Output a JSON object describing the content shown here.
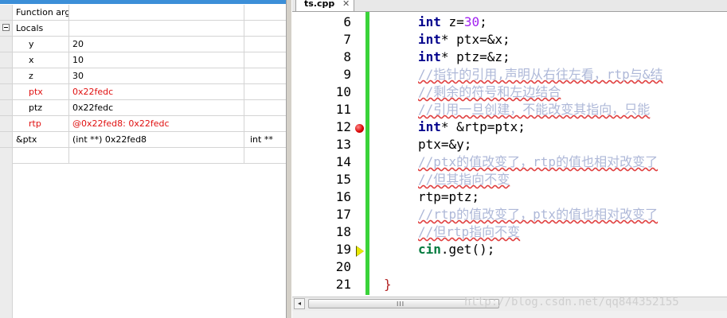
{
  "watch": {
    "function_arg_label": "Function arg",
    "locals_label": "Locals",
    "locals": [
      {
        "name": "y",
        "value": "20",
        "changed": false
      },
      {
        "name": "x",
        "value": "10",
        "changed": false
      },
      {
        "name": "z",
        "value": "30",
        "changed": false
      },
      {
        "name": "ptx",
        "value": "0x22fedc",
        "changed": true
      },
      {
        "name": "ptz",
        "value": "0x22fedc",
        "changed": false
      },
      {
        "name": "rtp",
        "value": "@0x22fed8: 0x22fedc",
        "changed": true
      }
    ],
    "expression": {
      "name": "&ptx",
      "value": "(int **) 0x22fed8",
      "type": "int **"
    }
  },
  "editor": {
    "tab_name": "ts.cpp",
    "tab_close": "✕",
    "lines": [
      {
        "n": "6"
      },
      {
        "n": "7"
      },
      {
        "n": "8"
      },
      {
        "n": "9"
      },
      {
        "n": "10"
      },
      {
        "n": "11"
      },
      {
        "n": "12"
      },
      {
        "n": "13"
      },
      {
        "n": "14"
      },
      {
        "n": "15"
      },
      {
        "n": "16"
      },
      {
        "n": "17"
      },
      {
        "n": "18"
      },
      {
        "n": "19"
      },
      {
        "n": "20"
      },
      {
        "n": "21"
      }
    ],
    "code": {
      "l6": {
        "kw": "int",
        "rest": " z=",
        "num": "30",
        "end": ";"
      },
      "l7": {
        "kw": "int",
        "rest": "* ptx=&x;"
      },
      "l8": {
        "kw": "int",
        "rest": "* ptz=&z;"
      },
      "l9": "//指针的引用,声明从右往左看，rtp与&结",
      "l10": "//剩余的符号和左边结合",
      "l11": "//引用一旦创建，不能改变其指向，只能",
      "l12": {
        "kw": "int",
        "rest": "* &rtp=ptx;"
      },
      "l13": "ptx=&y;",
      "l14": "//ptx的值改变了，rtp的值也相对改变了",
      "l15": "//但其指向不变",
      "l16": "rtp=ptz;",
      "l17": "//rtp的值改变了，ptx的值也相对改变了",
      "l18": "//但rtp指向不变",
      "l19": {
        "kw": "cin",
        "rest": ".get();"
      },
      "l21": "}"
    },
    "breakpoint_line": "12",
    "current_line": "19",
    "scroll_grip": "III",
    "scroll_left": "◂",
    "watermark": "http://blog.csdn.net/qq844352155"
  },
  "colors": {
    "keyword": "#00008b",
    "number": "#a020f0",
    "comment": "#aeb8d8",
    "changed_value": "#e01010",
    "gutter_marker": "#3ad33a",
    "breakpoint": "#d80000"
  }
}
